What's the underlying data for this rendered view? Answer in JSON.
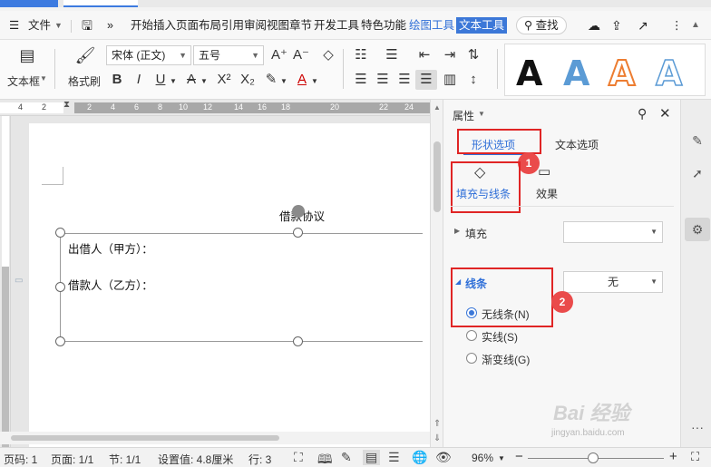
{
  "menubar": {
    "file_label": "文件",
    "items": [
      "开始",
      "插入",
      "页面布局",
      "引用",
      "审阅",
      "视图",
      "章节",
      "开发工具",
      "特色功能"
    ],
    "drawing_tools": "绘图工具",
    "text_tools": "文本工具",
    "search": "查找"
  },
  "ribbon": {
    "textbox_label": "文本框",
    "format_painter": "格式刷",
    "font_name": "宋体 (正文)",
    "font_size": "五号",
    "style_letter": "A"
  },
  "ruler": {
    "ticks": [
      "4",
      "2",
      "2",
      "4",
      "6",
      "8",
      "10",
      "12",
      "14",
      "16",
      "18",
      "20",
      "22",
      "24"
    ]
  },
  "document": {
    "title": "借款协议",
    "line1": "出借人（甲方）：",
    "line2": "借款人（乙方）："
  },
  "panel": {
    "header": "属性",
    "tab_shape": "形状选项",
    "tab_text": "文本选项",
    "sub_fill_line": "填充与线条",
    "sub_effect": "效果",
    "fill_label": "填充",
    "line_label": "线条",
    "line_value": "无",
    "opt_none": "无线条(N)",
    "opt_solid": "实线(S)",
    "opt_gradient": "渐变线(G)",
    "badge1": "1",
    "badge2": "2"
  },
  "statusbar": {
    "page_code": "页码: 1",
    "page": "页面: 1/1",
    "section": "节: 1/1",
    "setting": "设置值: 4.8厘米",
    "row": "行: 3",
    "zoom": "96%"
  },
  "watermark": {
    "brand": "Bai 经验",
    "url": "jingyan.baidu.com"
  }
}
